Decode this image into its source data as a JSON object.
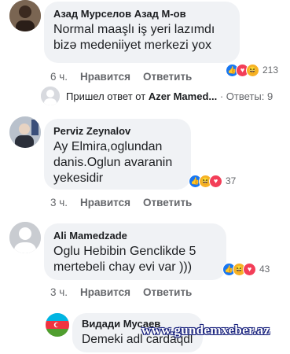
{
  "comments": [
    {
      "author": "Азад Мурселов Азад М-ов",
      "text": "Normal maaşlı iş yeri lazımdı bizə medeniiyet merkezi yox",
      "time": "6 ч.",
      "like_label": "Нравится",
      "reply_label": "Ответить",
      "reaction_count": "213",
      "reactions": [
        "like",
        "love",
        "haha"
      ]
    },
    {
      "author": "Perviz Zeynalov",
      "text": "Ay Elmira,oglundan danis.Oglun avaranin yekesidir",
      "time": "3 ч.",
      "like_label": "Нравится",
      "reply_label": "Ответить",
      "reaction_count": "37",
      "reactions": [
        "like",
        "haha",
        "love"
      ]
    },
    {
      "author": "Ali Mamedzade",
      "text": "Oglu Hebibin Genclikde 5 mertebeli chay evi var )))",
      "time": "3 ч.",
      "like_label": "Нравится",
      "reply_label": "Ответить",
      "reaction_count": "43",
      "reactions": [
        "like",
        "haha",
        "love"
      ]
    }
  ],
  "reply_summary": {
    "prefix": "Пришел ответ от",
    "name": "Azer Mamed...",
    "replies": "· Ответы: 9"
  },
  "reply": {
    "author": "Видади Мусаев",
    "text": "Demeki adl cardaqdl"
  },
  "watermark": "www.gundemxeber.az"
}
